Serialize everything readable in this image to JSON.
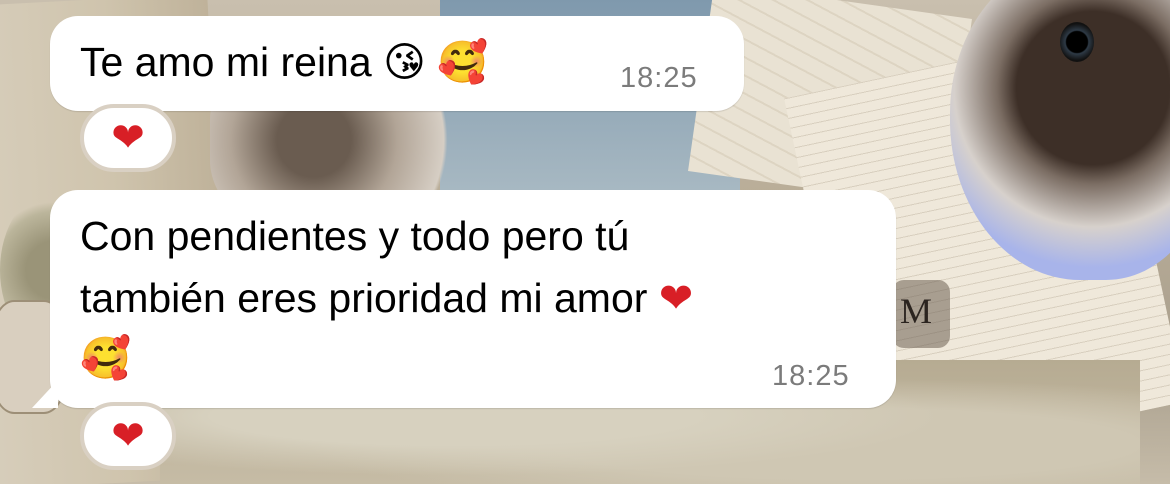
{
  "messages": [
    {
      "text": "Te amo mi reina",
      "emojis": [
        "😘",
        "🥰"
      ],
      "time": "18:25",
      "reaction": "❤"
    },
    {
      "line1": "Con pendientes y todo pero tú",
      "line2": "también eres prioridad mi amor",
      "heart": "❤",
      "emoji": "🥰",
      "time": "18:25",
      "reaction": "❤"
    }
  ],
  "wallpaper": {
    "m_letter": "M"
  },
  "colors": {
    "bubble": "#ffffff",
    "heart": "#d81f26",
    "time": "#7b7b7b"
  }
}
